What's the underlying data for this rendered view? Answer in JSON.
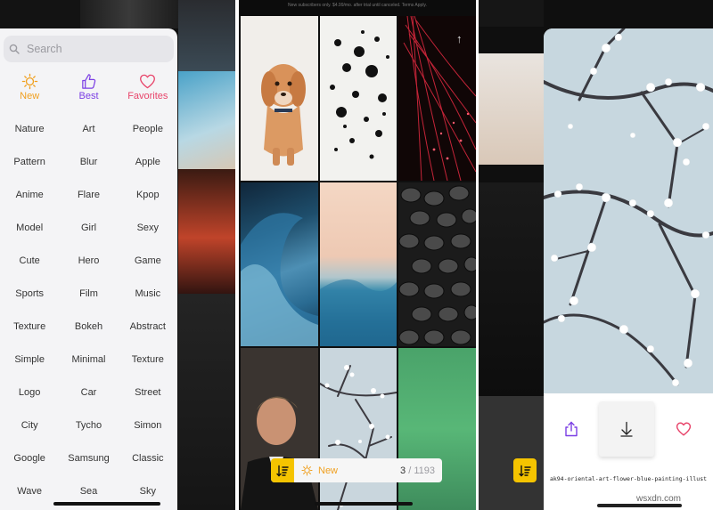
{
  "drawer": {
    "search_placeholder": "Search",
    "tabs": [
      {
        "label": "New",
        "icon": "sun-icon",
        "color": "#f0a020"
      },
      {
        "label": "Best",
        "icon": "thumbs-up-icon",
        "color": "#7b3fe4"
      },
      {
        "label": "Favorites",
        "icon": "heart-icon",
        "color": "#e8446a"
      }
    ],
    "categories": [
      "Nature",
      "Art",
      "People",
      "Pattern",
      "Blur",
      "Apple",
      "Anime",
      "Flare",
      "Kpop",
      "Model",
      "Girl",
      "Sexy",
      "Cute",
      "Hero",
      "Game",
      "Sports",
      "Film",
      "Music",
      "Texture",
      "Bokeh",
      "Abstract",
      "Simple",
      "Minimal",
      "Texture",
      "Logo",
      "Car",
      "Street",
      "City",
      "Tycho",
      "Simon",
      "Google",
      "Samsung",
      "Classic",
      "Wave",
      "Sea",
      "Sky"
    ]
  },
  "grid_view": {
    "top_banner": "New subscribers only. $4.99/mo. after trial until canceled. Terms Apply.",
    "badge_letter": "P",
    "scroll_up_icon": "arrow-up-icon",
    "bottom_bar": {
      "sort_icon": "sort-icon",
      "filter_icon": "sun-icon",
      "filter_label": "New",
      "current": "3",
      "separator": "/",
      "total": "1193"
    }
  },
  "detail_view": {
    "share_icon": "share-icon",
    "download_icon": "download-icon",
    "favorite_icon": "heart-icon",
    "file_name": "ak94-oriental-art-flower-blue-painting-illust"
  },
  "watermark": "wsxdn.com",
  "colors": {
    "accent_yellow": "#f5c400",
    "new_orange": "#f0a020",
    "best_purple": "#7b3fe4",
    "favorite_pink": "#e8446a"
  }
}
